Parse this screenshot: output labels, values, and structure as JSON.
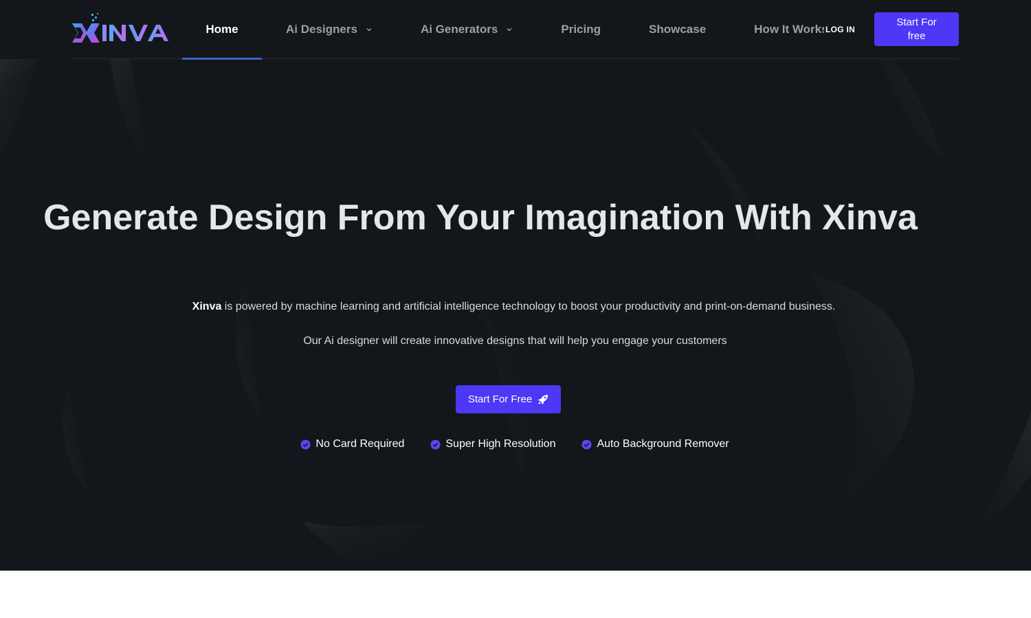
{
  "brand": {
    "name": "XINVA",
    "logo_icon": "xinva-logo",
    "accent": "#4d38f5",
    "nav_underline": "#3a63c9"
  },
  "header": {
    "nav": [
      {
        "label": "Home",
        "active": true
      },
      {
        "label": "Ai Designers",
        "dropdown": true
      },
      {
        "label": "Ai Generators",
        "dropdown": true
      },
      {
        "label": "Pricing"
      },
      {
        "label": "Showcase"
      },
      {
        "label": "How It Works"
      }
    ],
    "login_label": "LOG IN",
    "start_label": "Start For free"
  },
  "hero": {
    "title": "Generate Design From Your Imagination With Xinva",
    "sub1_brand": "Xinva",
    "sub1_rest": " is powered by machine learning and artificial intelligence technology to boost your productivity and print-on-demand business.",
    "sub2": "Our Ai designer will create innovative designs that will help you engage your customers",
    "cta_label": "Start For Free",
    "cta_icon": "rocket-icon",
    "features": [
      {
        "label": "No Card Required",
        "icon": "check-circle-icon"
      },
      {
        "label": "Super High Resolution",
        "icon": "check-circle-icon"
      },
      {
        "label": "Auto Background Remover",
        "icon": "check-circle-icon"
      }
    ]
  }
}
